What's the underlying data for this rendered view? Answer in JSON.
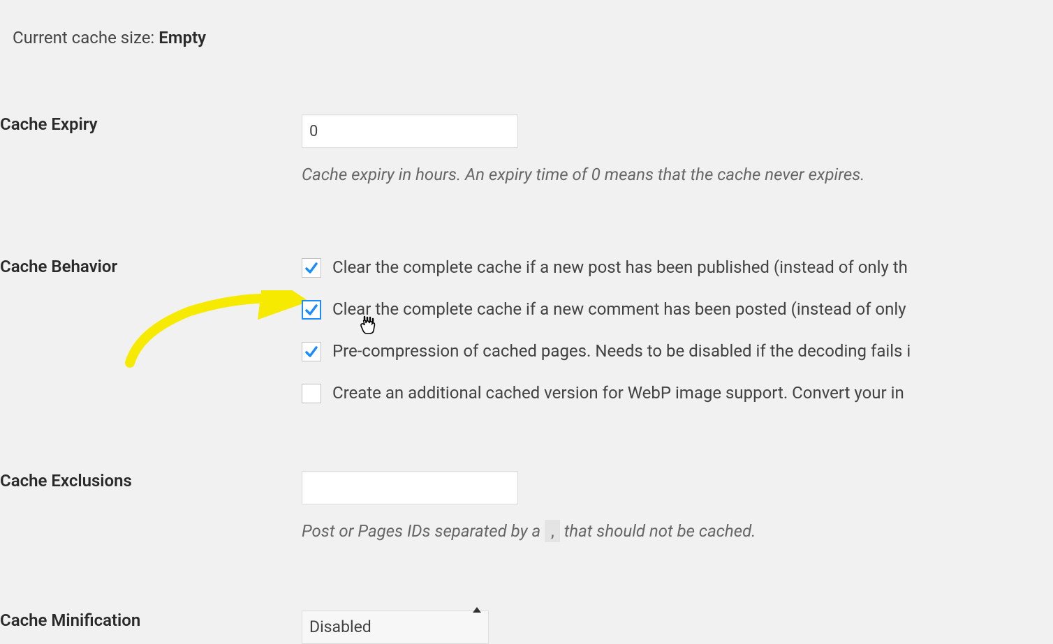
{
  "status": {
    "label": "Current cache size: ",
    "value": "Empty"
  },
  "expiry": {
    "heading": "Cache Expiry",
    "value": "0",
    "description": "Cache expiry in hours. An expiry time of 0 means that the cache never expires."
  },
  "behavior": {
    "heading": "Cache Behavior",
    "items": [
      {
        "checked": true,
        "highlight": false,
        "label": "Clear the complete cache if a new post has been published (instead of only th"
      },
      {
        "checked": true,
        "highlight": true,
        "label": "Clear the complete cache if a new comment has been posted (instead of only "
      },
      {
        "checked": true,
        "highlight": false,
        "label": "Pre-compression of cached pages. Needs to be disabled if the decoding fails i"
      },
      {
        "checked": false,
        "highlight": false,
        "label": "Create an additional cached version for WebP image support. Convert your in"
      }
    ]
  },
  "exclusions": {
    "heading": "Cache Exclusions",
    "value": "",
    "description_pre": "Post or Pages IDs separated by a",
    "description_code": ",",
    "description_post": "that should not be cached."
  },
  "minification": {
    "heading": "Cache Minification",
    "selected": "Disabled"
  }
}
